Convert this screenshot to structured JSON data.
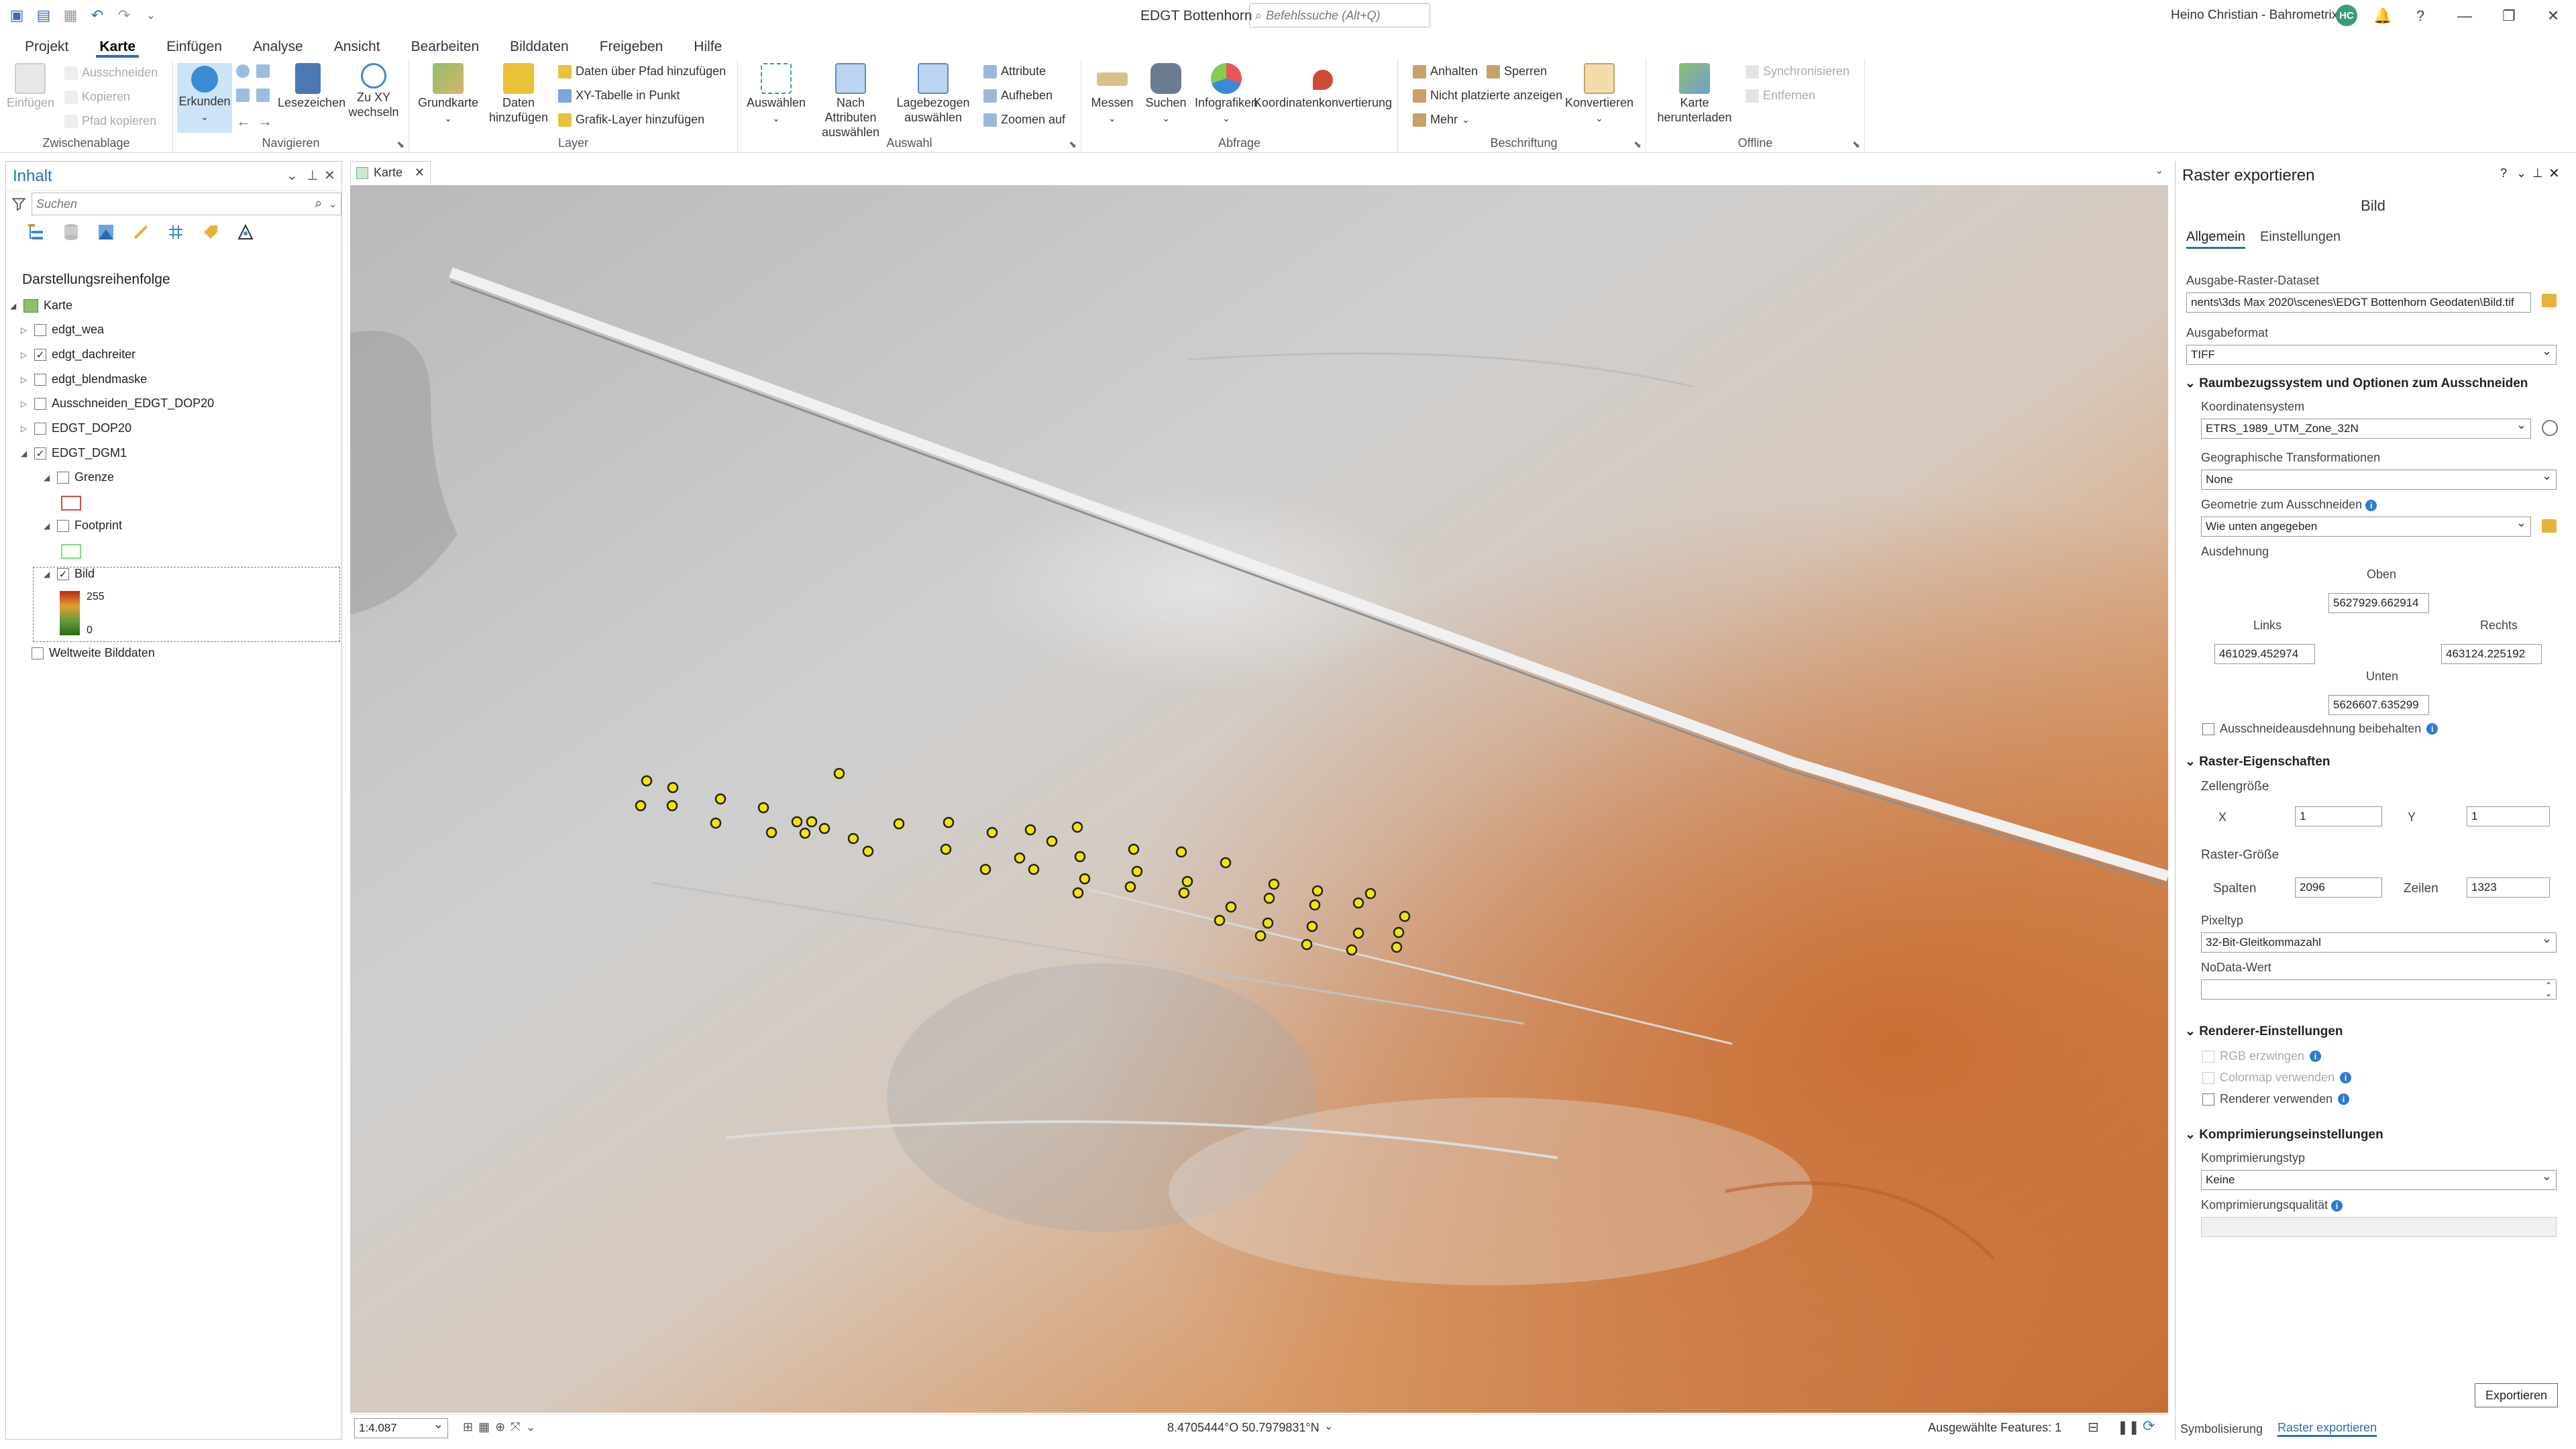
{
  "app": {
    "doc_title": "EDGT Bottenhorn",
    "search_placeholder": "Befehlssuche (Alt+Q)",
    "user": "Heino Christian - Bahrometrix",
    "avatar": "HC"
  },
  "menu": [
    "Projekt",
    "Karte",
    "Einfügen",
    "Analyse",
    "Ansicht",
    "Bearbeiten",
    "Bilddaten",
    "Freigeben",
    "Hilfe"
  ],
  "ribbon": {
    "clipboard": {
      "title": "Zwischenablage",
      "paste": "Einfügen",
      "cut": "Ausschneiden",
      "copy": "Kopieren",
      "copy_path": "Pfad kopieren"
    },
    "navigate": {
      "title": "Navigieren",
      "explore": "Erkunden",
      "bookmarks": "Lesezeichen",
      "goto_xy": "Zu XY wechseln"
    },
    "layer": {
      "title": "Layer",
      "basemap": "Grundkarte",
      "add_data": "Daten hinzufügen",
      "add_from_path": "Daten über Pfad hinzufügen",
      "xy_to_point": "XY-Tabelle in Punkt",
      "add_graphics": "Grafik-Layer hinzufügen"
    },
    "selection": {
      "title": "Auswahl",
      "select": "Auswählen",
      "by_attr": "Nach Attributen auswählen",
      "by_loc": "Lagebezogen auswählen",
      "attributes": "Attribute",
      "clear": "Aufheben",
      "zoom_to": "Zoomen auf"
    },
    "inquiry": {
      "title": "Abfrage",
      "measure": "Messen",
      "locate": "Suchen",
      "infographics": "Infografiken",
      "coord_conv": "Koordinatenkonvertierung"
    },
    "labeling": {
      "title": "Beschriftung",
      "pause": "Anhalten",
      "lock": "Sperren",
      "unplaced": "Nicht platzierte anzeigen",
      "more": "Mehr",
      "convert": "Konvertieren"
    },
    "offline": {
      "title": "Offline",
      "download_map": "Karte herunterladen",
      "sync": "Synchronisieren",
      "remove": "Entfernen"
    }
  },
  "toc": {
    "title": "Inhalt",
    "search_placeholder": "Suchen",
    "heading": "Darstellungsreihenfolge",
    "map": "Karte",
    "layers": [
      {
        "name": "edgt_wea",
        "checked": false
      },
      {
        "name": "edgt_dachreiter",
        "checked": true
      },
      {
        "name": "edgt_blendmaske",
        "checked": false
      },
      {
        "name": "Ausschneiden_EDGT_DOP20",
        "checked": false
      },
      {
        "name": "EDGT_DOP20",
        "checked": false
      },
      {
        "name": "EDGT_DGM1",
        "checked": true
      }
    ],
    "sub": {
      "grenze": "Grenze",
      "footprint": "Footprint",
      "bild": "Bild",
      "max": "255",
      "min": "0"
    },
    "worldwide": "Weltweite Bilddaten"
  },
  "map": {
    "tab": "Karte",
    "scale": "1:4.087",
    "coords": "8.4705444°O 50.7979831°N",
    "selected": "Ausgewählte Features: 1",
    "point_color": "#f2e600"
  },
  "panel": {
    "title": "Raster exportieren",
    "subtitle": "Bild",
    "tab_general": "Allgemein",
    "tab_settings": "Einstellungen",
    "out_label": "Ausgabe-Raster-Dataset",
    "out_value": "nents\\3ds Max 2020\\scenes\\EDGT Bottenhorn Geodaten\\Bild.tif",
    "format_label": "Ausgabeformat",
    "format_value": "TIFF",
    "sec_crs": "Raumbezugssystem und Optionen zum Ausschneiden",
    "crs_label": "Koordinatensystem",
    "crs_value": "ETRS_1989_UTM_Zone_32N",
    "geo_label": "Geographische Transformationen",
    "geo_value": "None",
    "clip_label": "Geometrie zum Ausschneiden",
    "clip_value": "Wie unten angegeben",
    "extent_label": "Ausdehnung",
    "top_label": "Oben",
    "top": "5627929.662914",
    "left_label": "Links",
    "left": "461029.452974",
    "right_label": "Rechts",
    "right": "463124.225192",
    "bottom_label": "Unten",
    "bottom": "5626607.635299",
    "keep_extent": "Ausschneideausdehnung beibehalten",
    "sec_raster": "Raster-Eigenschaften",
    "cell_label": "Zellengröße",
    "x_label": "X",
    "x": "1",
    "y_label": "Y",
    "y": "1",
    "size_label": "Raster-Größe",
    "cols_label": "Spalten",
    "cols": "2096",
    "rows_label": "Zeilen",
    "rows": "1323",
    "pixel_label": "Pixeltyp",
    "pixel_value": "32-Bit-Gleitkommazahl",
    "nodata_label": "NoData-Wert",
    "sec_renderer": "Renderer-Einstellungen",
    "rgb": "RGB erzwingen",
    "colormap": "Colormap verwenden",
    "renderer": "Renderer verwenden",
    "sec_comp": "Komprimierungseinstellungen",
    "comp_label": "Komprimierungstyp",
    "comp_value": "Keine",
    "quality_label": "Komprimierungsqualität",
    "export": "Exportieren",
    "bottom_tab1": "Symbolisierung",
    "bottom_tab2": "Raster exportieren"
  }
}
